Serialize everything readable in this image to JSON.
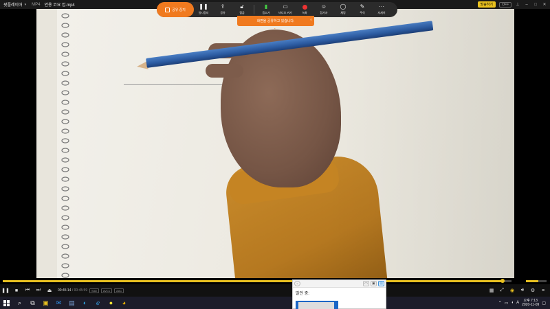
{
  "title_bar": {
    "app_name": "팟플레이어",
    "format": "MP4",
    "file_name": "언용 코요 업.mp4",
    "live_button": "방송하기",
    "live_off": "OFF"
  },
  "share_bar": {
    "stop_label": "공유 중지",
    "items": [
      {
        "label": "일시정지",
        "icon": "pause-icon"
      },
      {
        "label": "공유",
        "icon": "share-icon"
      },
      {
        "label": "잠금",
        "icon": "lock-icon"
      },
      {
        "label": "음소거",
        "icon": "mic-icon"
      },
      {
        "label": "비디오 켜기",
        "icon": "video-icon"
      },
      {
        "label": "녹화",
        "icon": "record-icon"
      },
      {
        "label": "참가자",
        "icon": "participants-icon"
      },
      {
        "label": "채팅",
        "icon": "chat-icon"
      },
      {
        "label": "주석",
        "icon": "annotate-icon"
      },
      {
        "label": "자세히",
        "icon": "more-icon"
      }
    ],
    "toast": "화면을 공유하고 있습니다."
  },
  "player": {
    "current_time": "00:45:14",
    "total_time": "00:45:59",
    "tags": [
      "S3D",
      "AVC1",
      "AAC"
    ],
    "progress_fraction": 0.983,
    "volume_fraction": 0.6
  },
  "speaker_panel": {
    "label": "발언 중:"
  },
  "taskbar": {
    "time": "오후 7:13",
    "date": "2020-11-09",
    "ime": "A"
  },
  "colors": {
    "accent_orange": "#f07a1f",
    "accent_yellow": "#e8c020"
  }
}
